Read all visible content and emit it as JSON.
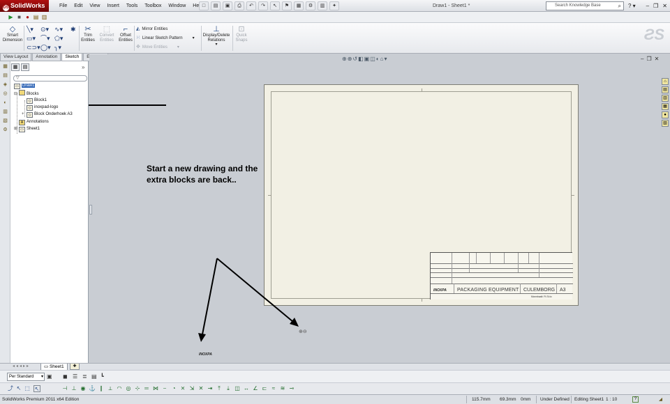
{
  "app": {
    "name": "SolidWorks",
    "doc_title": "Draw1 - Sheet1 *",
    "brand_color": "#b01010"
  },
  "menu": [
    "File",
    "Edit",
    "View",
    "Insert",
    "Tools",
    "Toolbox",
    "Window",
    "Help"
  ],
  "search": {
    "placeholder": "Search Knowledge Base"
  },
  "command_manager": {
    "smart_dimension": "Smart Dimension",
    "trim_entities": "Trim Entities",
    "convert_entities": "Convert Entities",
    "offset_entities": "Offset Entities",
    "mirror_entities": "Mirror Entities",
    "linear_sketch_pattern": "Linear Sketch Pattern",
    "move_entities": "Move Entities",
    "display_delete_relations": "Display/Delete Relations",
    "quick_snaps": "Quick Snaps"
  },
  "tabs": [
    {
      "label": "View Layout",
      "active": false
    },
    {
      "label": "Annotation",
      "active": false
    },
    {
      "label": "Sketch",
      "active": true
    },
    {
      "label": "Evaluate",
      "active": false
    }
  ],
  "feature_tree": {
    "root": "Draw1",
    "blocks_folder": "Blocks",
    "blocks": [
      "Block1",
      "inoxpad-logo",
      "Block Onderhoek A3"
    ],
    "annotations": "Annotations",
    "sheet": "Sheet1"
  },
  "drawing": {
    "company": "PACKAGING EQUIPMENT",
    "city": "CULEMBORG",
    "sheet_size": "A3",
    "scale_note": "Mannbaalt: Ft.St.to",
    "logo_text": "INOXPA"
  },
  "annotation_note": {
    "line1": "Start a new drawing and the",
    "line2": "extra blocks are back.."
  },
  "sheet_tabs": {
    "current": "Sheet1"
  },
  "layer_bar": {
    "layer": "Per Standard"
  },
  "status_bar": {
    "edition": "SolidWorks Premium 2011 x64 Edition",
    "x": "115.7mm",
    "y": "69.3mm",
    "z": "0mm",
    "state": "Under Defined",
    "editing": "Editing Sheet1",
    "scale": "1 : 10"
  }
}
